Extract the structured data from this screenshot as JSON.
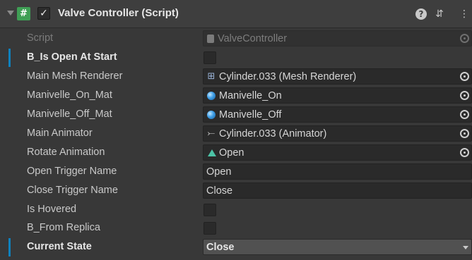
{
  "component": {
    "title": "Valve Controller (Script)",
    "enabled_checkmark": "✓",
    "script_glyph": "#",
    "help_glyph": "?",
    "presets_glyph": "⇵",
    "more_glyph": "⋮"
  },
  "fields": {
    "script": {
      "label": "Script",
      "value": "ValveController"
    },
    "b_is_open_at_start": {
      "label": "B_Is Open At Start",
      "checked": false
    },
    "main_mesh_renderer": {
      "label": "Main Mesh Renderer",
      "value": "Cylinder.033 (Mesh Renderer)",
      "icon": "mesh-renderer-icon"
    },
    "manivelle_on_mat": {
      "label": "Manivelle_On_Mat",
      "value": "Manivelle_On",
      "icon": "material-icon"
    },
    "manivelle_off_mat": {
      "label": "Manivelle_Off_Mat",
      "value": "Manivelle_Off",
      "icon": "material-icon"
    },
    "main_animator": {
      "label": "Main Animator",
      "value": "Cylinder.033 (Animator)",
      "icon": "animator-icon"
    },
    "rotate_animation": {
      "label": "Rotate Animation",
      "value": "Open",
      "icon": "animation-clip-icon"
    },
    "open_trigger_name": {
      "label": "Open Trigger Name",
      "value": "Open"
    },
    "close_trigger_name": {
      "label": "Close Trigger Name",
      "value": "Close"
    },
    "is_hovered": {
      "label": "Is Hovered",
      "checked": false
    },
    "b_from_replica": {
      "label": "B_From Replica",
      "checked": false
    },
    "current_state": {
      "label": "Current State",
      "value": "Close"
    }
  },
  "glyphs": {
    "mesh": "⊞",
    "animator": "⤚"
  },
  "colors": {
    "background": "#383838",
    "header": "#3e3e3e",
    "override_accent": "#0f81be",
    "script_icon": "#3f9f55"
  }
}
